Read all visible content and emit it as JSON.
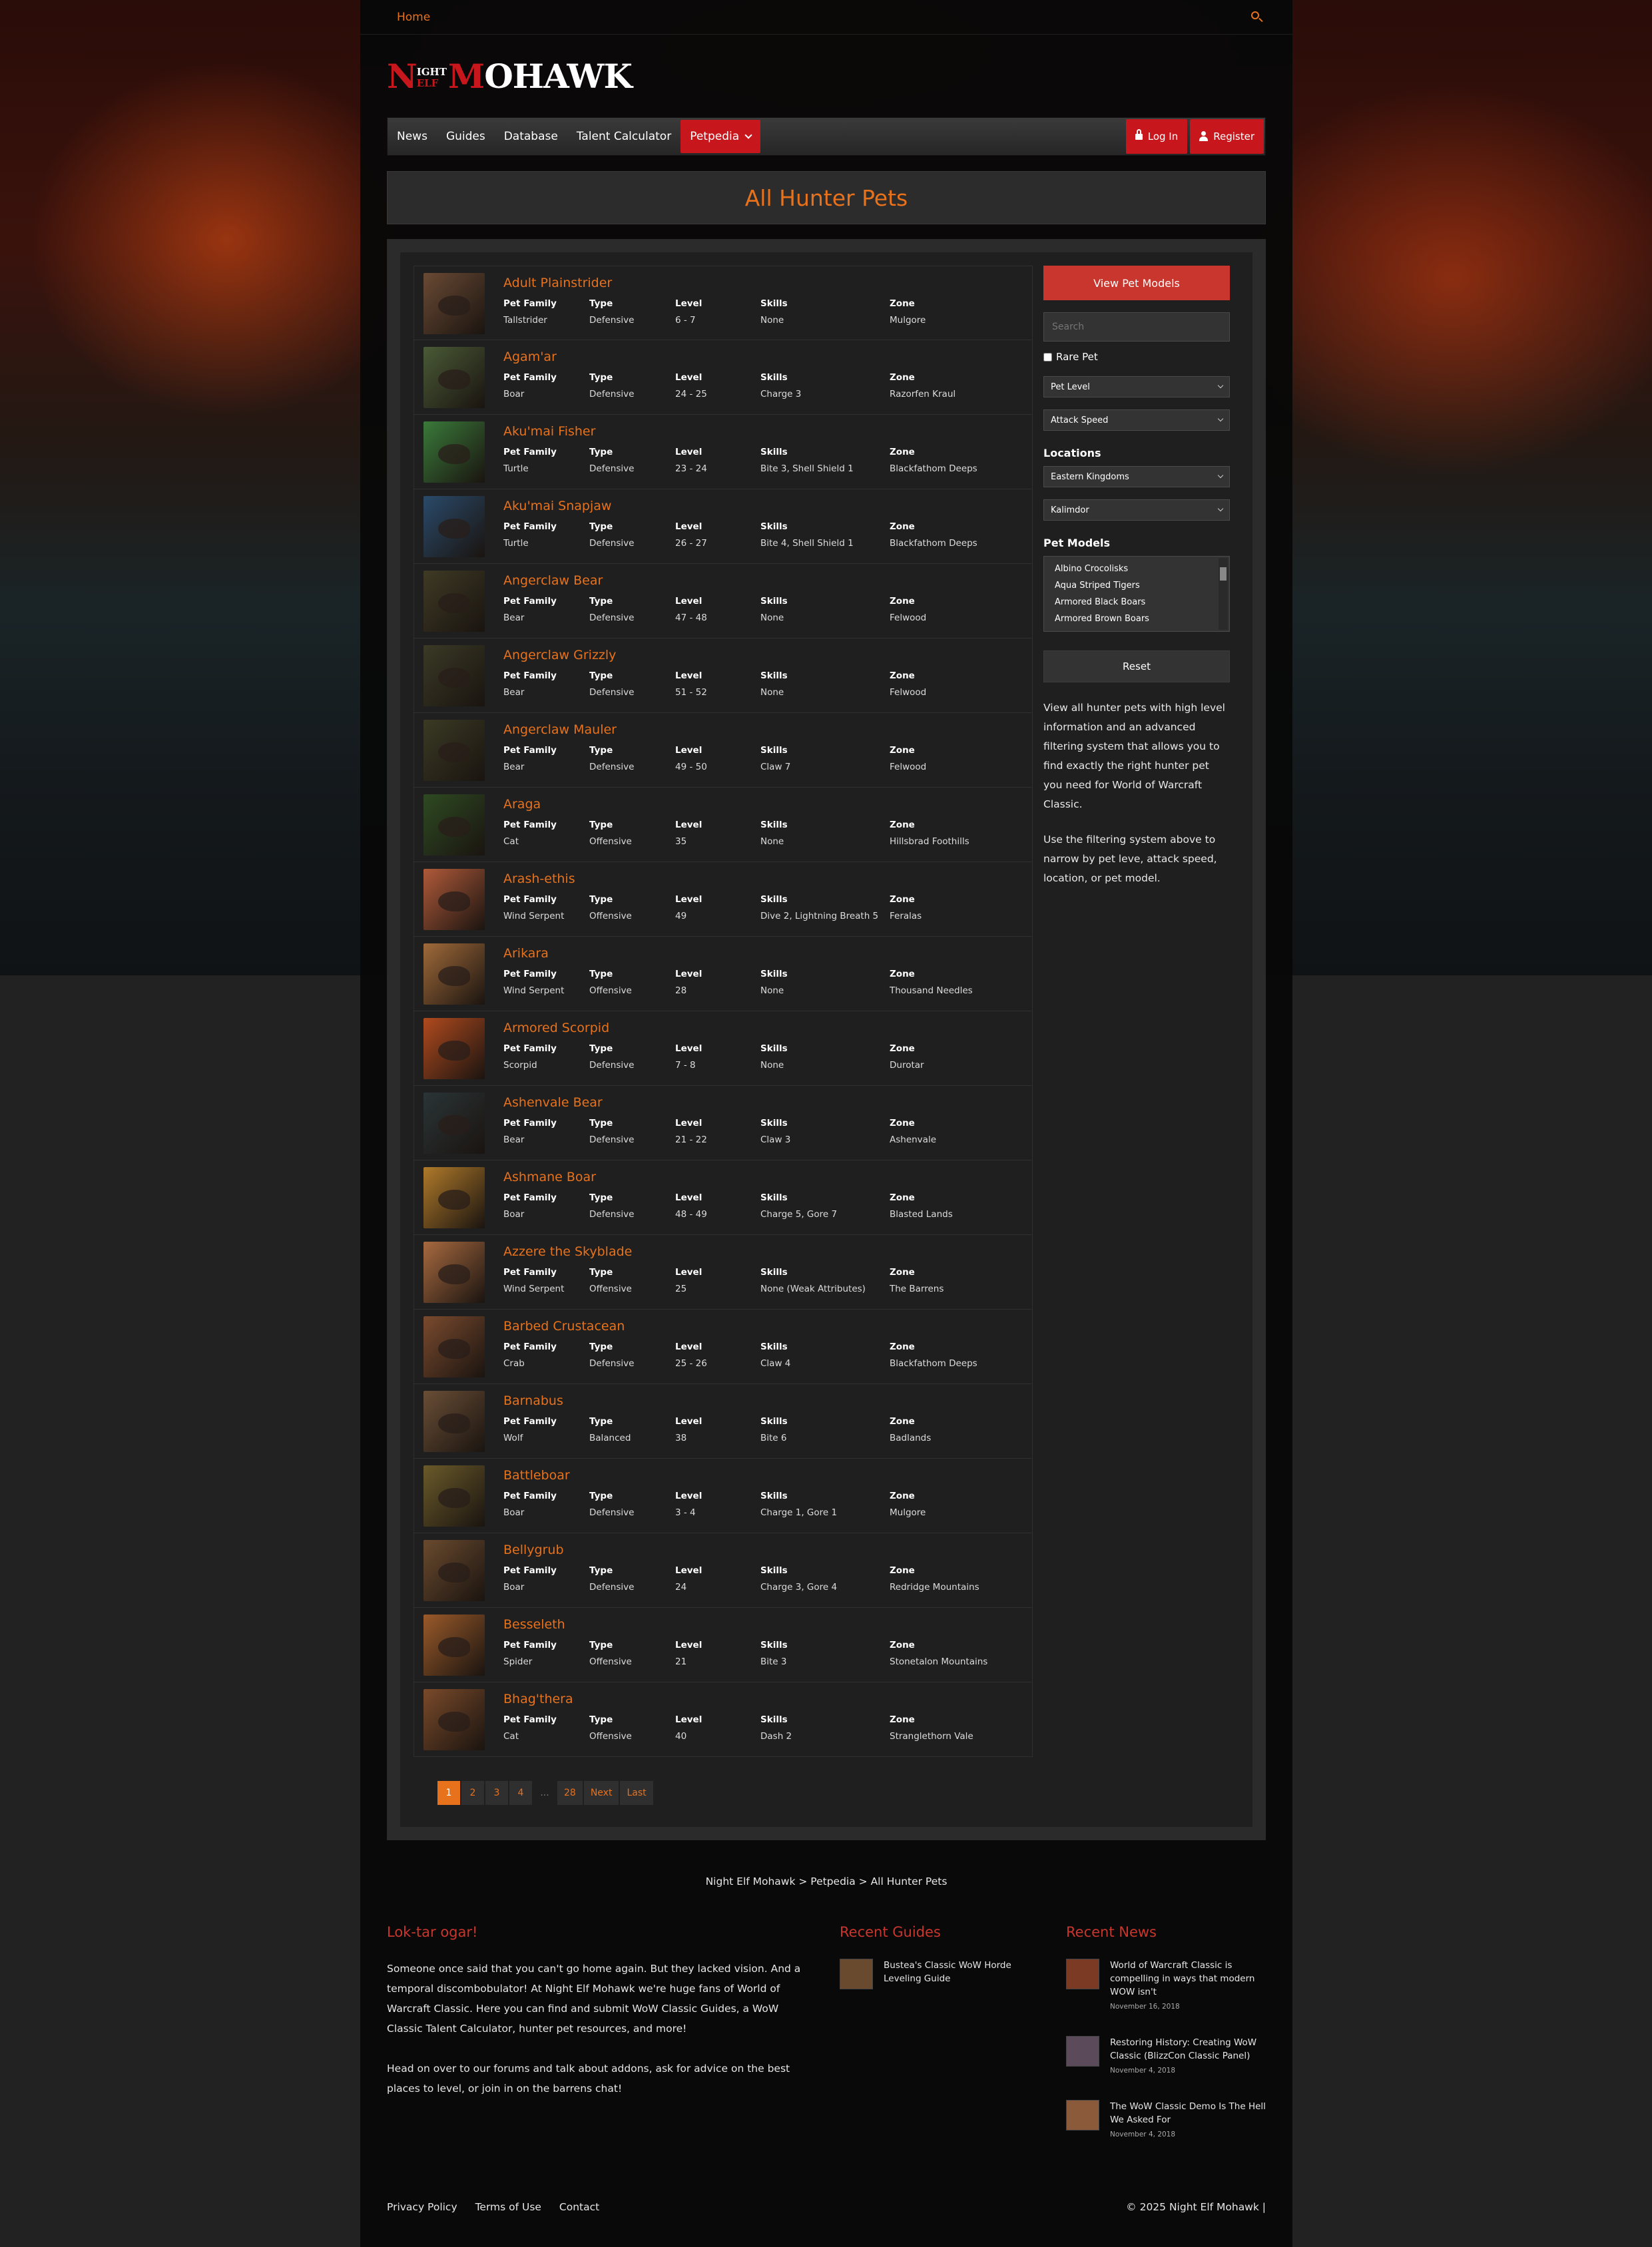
{
  "topbar": {
    "home": "Home"
  },
  "logo": {
    "n": "N",
    "night": "IGHT",
    "elf": "ELF",
    "m": "M",
    "rest": "OHAWK"
  },
  "nav": {
    "items": [
      "News",
      "Guides",
      "Database",
      "Talent Calculator",
      "Petpedia"
    ],
    "login": "Log In",
    "register": "Register"
  },
  "page": {
    "title": "All Hunter Pets"
  },
  "headers": {
    "family": "Pet Family",
    "type": "Type",
    "level": "Level",
    "skills": "Skills",
    "zone": "Zone"
  },
  "pets": [
    {
      "name": "Adult Plainstrider",
      "family": "Tallstrider",
      "type": "Defensive",
      "level": "6 - 7",
      "skills": "None",
      "zone": "Mulgore",
      "thumb": "#6a4a34"
    },
    {
      "name": "Agam'ar",
      "family": "Boar",
      "type": "Defensive",
      "level": "24 - 25",
      "skills": "Charge 3",
      "zone": "Razorfen Kraul",
      "thumb": "#4a5a36"
    },
    {
      "name": "Aku'mai Fisher",
      "family": "Turtle",
      "type": "Defensive",
      "level": "23 - 24",
      "skills": "Bite 3, Shell Shield 1",
      "zone": "Blackfathom Deeps",
      "thumb": "#3a7a3a"
    },
    {
      "name": "Aku'mai Snapjaw",
      "family": "Turtle",
      "type": "Defensive",
      "level": "26 - 27",
      "skills": "Bite 4, Shell Shield 1",
      "zone": "Blackfathom Deeps",
      "thumb": "#2a4a6a"
    },
    {
      "name": "Angerclaw Bear",
      "family": "Bear",
      "type": "Defensive",
      "level": "47 - 48",
      "skills": "None",
      "zone": "Felwood",
      "thumb": "#3e3a24"
    },
    {
      "name": "Angerclaw Grizzly",
      "family": "Bear",
      "type": "Defensive",
      "level": "51 - 52",
      "skills": "None",
      "zone": "Felwood",
      "thumb": "#3a3a26"
    },
    {
      "name": "Angerclaw Mauler",
      "family": "Bear",
      "type": "Defensive",
      "level": "49 - 50",
      "skills": "Claw 7",
      "zone": "Felwood",
      "thumb": "#3a3a24"
    },
    {
      "name": "Araga",
      "family": "Cat",
      "type": "Offensive",
      "level": "35",
      "skills": "None",
      "zone": "Hillsbrad Foothills",
      "thumb": "#2e4a22"
    },
    {
      "name": "Arash-ethis",
      "family": "Wind Serpent",
      "type": "Offensive",
      "level": "49",
      "skills": "Dive 2, Lightning Breath 5",
      "zone": "Feralas",
      "thumb": "#b05a3a"
    },
    {
      "name": "Arikara",
      "family": "Wind Serpent",
      "type": "Offensive",
      "level": "28",
      "skills": "None",
      "zone": "Thousand Needles",
      "thumb": "#a06a3a"
    },
    {
      "name": "Armored Scorpid",
      "family": "Scorpid",
      "type": "Defensive",
      "level": "7 - 8",
      "skills": "None",
      "zone": "Durotar",
      "thumb": "#b04a1e"
    },
    {
      "name": "Ashenvale Bear",
      "family": "Bear",
      "type": "Defensive",
      "level": "21 - 22",
      "skills": "Claw 3",
      "zone": "Ashenvale",
      "thumb": "#2a3436"
    },
    {
      "name": "Ashmane Boar",
      "family": "Boar",
      "type": "Defensive",
      "level": "48 - 49",
      "skills": "Charge 5, Gore 7",
      "zone": "Blasted Lands",
      "thumb": "#b07a2a"
    },
    {
      "name": "Azzere the Skyblade",
      "family": "Wind Serpent",
      "type": "Offensive",
      "level": "25",
      "skills": "None (Weak Attributes)",
      "zone": "The Barrens",
      "thumb": "#a86a40"
    },
    {
      "name": "Barbed Crustacean",
      "family": "Crab",
      "type": "Defensive",
      "level": "25 - 26",
      "skills": "Claw 4",
      "zone": "Blackfathom Deeps",
      "thumb": "#7a4a2e"
    },
    {
      "name": "Barnabus",
      "family": "Wolf",
      "type": "Balanced",
      "level": "38",
      "skills": "Bite 6",
      "zone": "Badlands",
      "thumb": "#6a4e36"
    },
    {
      "name": "Battleboar",
      "family": "Boar",
      "type": "Defensive",
      "level": "3 - 4",
      "skills": "Charge 1, Gore 1",
      "zone": "Mulgore",
      "thumb": "#6a5a2a"
    },
    {
      "name": "Bellygrub",
      "family": "Boar",
      "type": "Defensive",
      "level": "24",
      "skills": "Charge 3, Gore 4",
      "zone": "Redridge Mountains",
      "thumb": "#6a4a2e"
    },
    {
      "name": "Besseleth",
      "family": "Spider",
      "type": "Offensive",
      "level": "21",
      "skills": "Bite 3",
      "zone": "Stonetalon Mountains",
      "thumb": "#9a5a2a"
    },
    {
      "name": "Bhag'thera",
      "family": "Cat",
      "type": "Offensive",
      "level": "40",
      "skills": "Dash 2",
      "zone": "Stranglethorn Vale",
      "thumb": "#7a4a2a"
    }
  ],
  "pagination": {
    "pages": [
      "1",
      "2",
      "3",
      "4"
    ],
    "dots": "...",
    "last_page": "28",
    "next": "Next",
    "last": "Last"
  },
  "sidebar": {
    "view_models": "View Pet Models",
    "search_placeholder": "Search",
    "rare_pet": "Rare Pet",
    "pet_level": "Pet Level",
    "attack_speed": "Attack Speed",
    "locations_heading": "Locations",
    "location_1": "Eastern Kingdoms",
    "location_2": "Kalimdor",
    "models_heading": "Pet Models",
    "models": [
      "Albino Crocolisks",
      "Aqua Striped Tigers",
      "Armored Black Boars",
      "Armored Brown Boars"
    ],
    "reset": "Reset",
    "text_1": "View all hunter pets with high level information and an advanced filtering system that allows you to find exactly the right hunter pet you need for World of Warcraft Classic.",
    "text_2": "Use the filtering system above to narrow by pet leve, attack speed, location, or pet model."
  },
  "breadcrumb": "Night Elf Mohawk > Petpedia > All Hunter Pets",
  "footer": {
    "about_title": "Lok-tar ogar!",
    "about_1": "Someone once said that you can't go home again. But they lacked vision. And a temporal discombobulator! At Night Elf Mohawk we're huge fans of World of Warcraft Classic. Here you can find and submit WoW Classic Guides, a WoW Classic Talent Calculator, hunter pet resources, and more!",
    "about_2": "Head on over to our forums and talk about addons, ask for advice on the best places to level, or join in on the barrens chat!",
    "guides_title": "Recent Guides",
    "guides": [
      {
        "title": "Bustea's Classic WoW Horde Leveling Guide"
      }
    ],
    "news_title": "Recent News",
    "news": [
      {
        "title": "World of Warcraft Classic is compelling in ways that modern WOW isn't",
        "date": "November 16, 2018"
      },
      {
        "title": "Restoring History: Creating WoW Classic (BlizzCon Classic Panel)",
        "date": "November 4, 2018"
      },
      {
        "title": "The WoW Classic Demo Is The Hell We Asked For",
        "date": "November 4, 2018"
      }
    ]
  },
  "legal": {
    "privacy": "Privacy Policy",
    "terms": "Terms of Use",
    "contact": "Contact",
    "copyright": "© 2025 Night Elf Mohawk |"
  },
  "colors": {
    "accent": "#e8721c",
    "brand_red": "#c8161d"
  }
}
